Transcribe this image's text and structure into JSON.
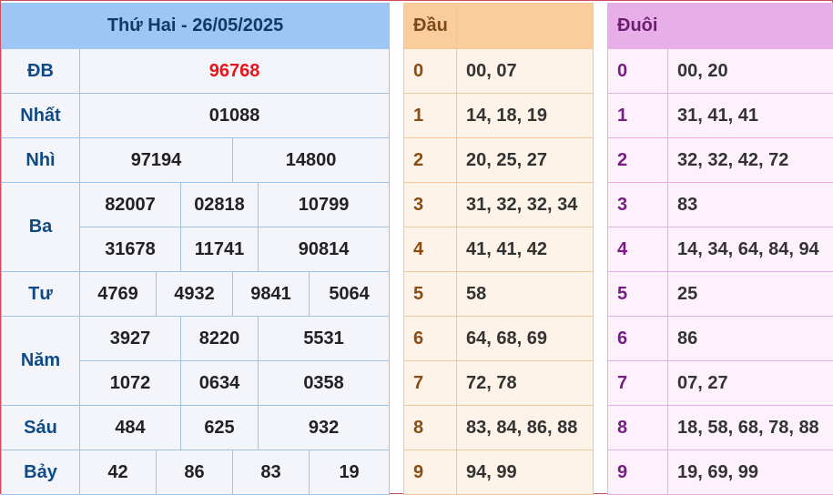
{
  "results": {
    "date_title": "Thứ Hai - 26/05/2025",
    "prizes": [
      {
        "label": "ĐB",
        "values": [
          "96768"
        ]
      },
      {
        "label": "Nhất",
        "values": [
          "01088"
        ]
      },
      {
        "label": "Nhì",
        "values": [
          "97194",
          "14800"
        ]
      },
      {
        "label": "Ba",
        "values": [
          "82007",
          "02818",
          "10799",
          "31678",
          "11741",
          "90814"
        ]
      },
      {
        "label": "Tư",
        "values": [
          "4769",
          "4932",
          "9841",
          "5064"
        ]
      },
      {
        "label": "Năm",
        "values": [
          "3927",
          "8220",
          "5531",
          "1072",
          "0634",
          "0358"
        ]
      },
      {
        "label": "Sáu",
        "values": [
          "484",
          "625",
          "932"
        ]
      },
      {
        "label": "Bảy",
        "values": [
          "42",
          "86",
          "83",
          "19"
        ]
      }
    ]
  },
  "dau": {
    "header": "Đầu",
    "rows": [
      {
        "key": "0",
        "value": "00, 07"
      },
      {
        "key": "1",
        "value": "14, 18, 19"
      },
      {
        "key": "2",
        "value": "20, 25, 27"
      },
      {
        "key": "3",
        "value": "31, 32, 32, 34"
      },
      {
        "key": "4",
        "value": "41, 41, 42"
      },
      {
        "key": "5",
        "value": "58"
      },
      {
        "key": "6",
        "value": "64, 68, 69"
      },
      {
        "key": "7",
        "value": "72, 78"
      },
      {
        "key": "8",
        "value": "83, 84, 86, 88"
      },
      {
        "key": "9",
        "value": "94, 99"
      }
    ]
  },
  "duoi": {
    "header": "Đuôi",
    "rows": [
      {
        "key": "0",
        "value": "00, 20"
      },
      {
        "key": "1",
        "value": "31, 41, 41"
      },
      {
        "key": "2",
        "value": "32, 32, 42, 72"
      },
      {
        "key": "3",
        "value": "83"
      },
      {
        "key": "4",
        "value": "14, 34, 64, 84, 94"
      },
      {
        "key": "5",
        "value": "25"
      },
      {
        "key": "6",
        "value": "86"
      },
      {
        "key": "7",
        "value": "07, 27"
      },
      {
        "key": "8",
        "value": "18, 58, 68, 78, 88"
      },
      {
        "key": "9",
        "value": "19, 69, 99"
      }
    ]
  },
  "colors": {
    "special_prize": "#e8141b",
    "main_header_bg": "#9ec6f4",
    "dau_header_bg": "#fbcc9c",
    "duoi_header_bg": "#e7aee8"
  }
}
